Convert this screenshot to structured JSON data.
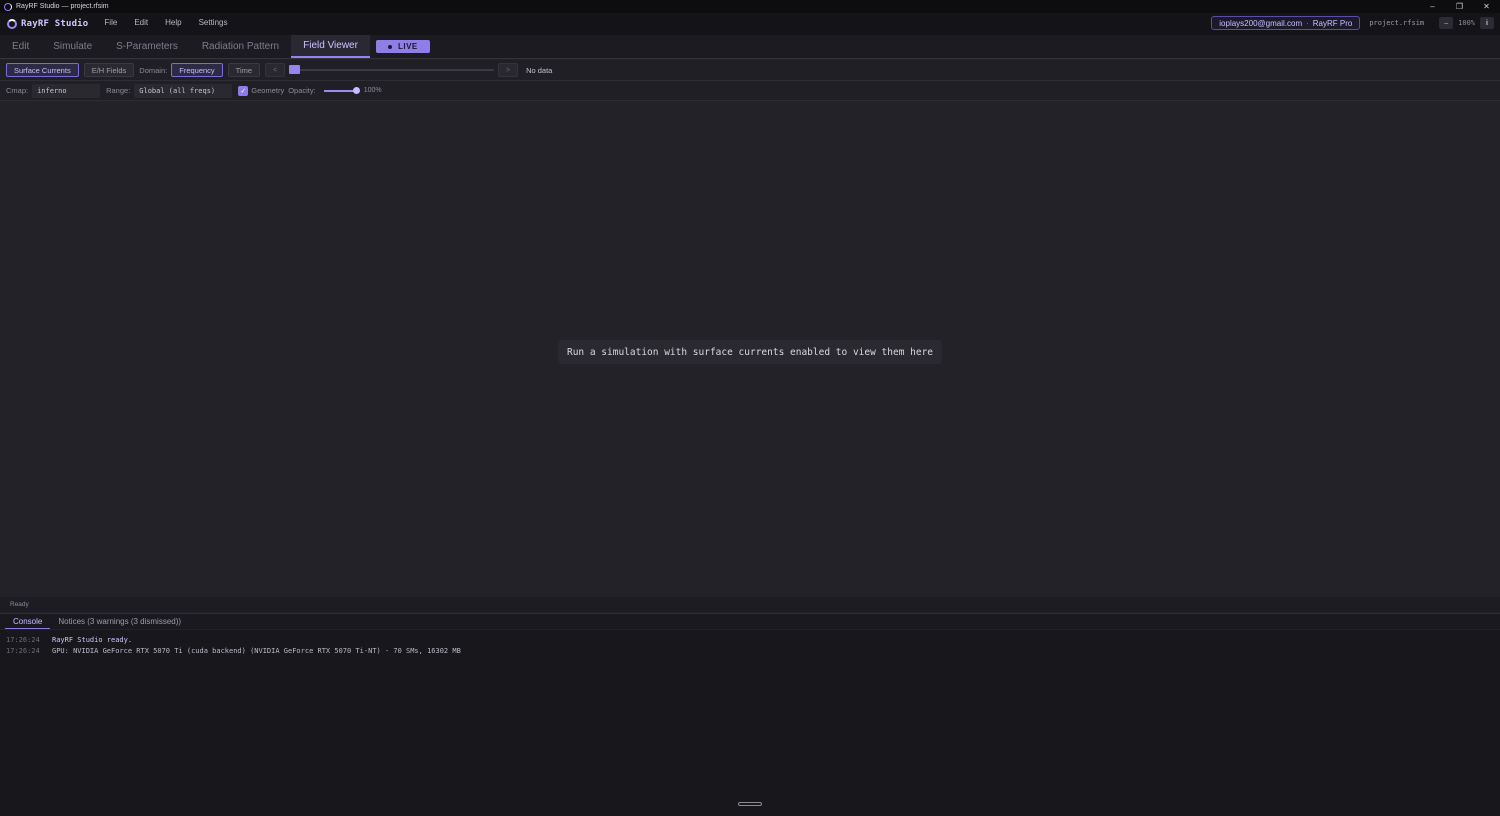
{
  "window": {
    "title": "RayRF Studio — project.rfsim",
    "controls": [
      "–",
      "❐",
      "✕"
    ]
  },
  "header": {
    "brand": "RayRF Studio",
    "menu": [
      "File",
      "Edit",
      "Help",
      "Settings"
    ],
    "account_email": "ioplays200@gmail.com",
    "account_sep": "·",
    "account_plan": "RayRF Pro",
    "project": "project.rfsim",
    "zoom_minus": "–",
    "zoom": "100%",
    "info_btn": "i"
  },
  "tabs": [
    {
      "label": "Edit"
    },
    {
      "label": "Simulate"
    },
    {
      "label": "S-Parameters"
    },
    {
      "label": "Radiation Pattern"
    },
    {
      "label": "Field Viewer"
    }
  ],
  "live_badge": "LIVE",
  "toolbar1": {
    "surface_currents": "Surface Currents",
    "eh_fields": "E/H Fields",
    "domain_label": "Domain:",
    "frequency": "Frequency",
    "time": "Time",
    "prev": "<",
    "next": ">",
    "slider_position": 0,
    "status": "No data"
  },
  "toolbar2": {
    "cmap_label": "Cmap:",
    "cmap_value": "inferno",
    "range_label": "Range:",
    "range_value": "Global (all freqs)",
    "geometry_check": "✓",
    "geometry_label": "Geometry",
    "opacity_label": "Opacity:",
    "opacity_value": 1.0,
    "opacity_text": "100%"
  },
  "viewport": {
    "message": "Run a simulation with surface currents enabled to view them here"
  },
  "statusbar": {
    "text": "Ready"
  },
  "bottom": {
    "tabs": [
      "Console",
      "Notices (3 warnings (3 dismissed))"
    ],
    "log": [
      {
        "time": "17:26:24",
        "msg": "RayRF Studio ready."
      },
      {
        "time": "17:26:24",
        "msg": "GPU: NVIDIA GeForce RTX 5070 Ti (cuda backend) (NVIDIA GeForce RTX 5070 Ti-NT) - 70 SMs, 16302 MB"
      }
    ]
  },
  "colors": {
    "accent": "#9382f0",
    "background": "#232228",
    "panel": "#18171c"
  }
}
